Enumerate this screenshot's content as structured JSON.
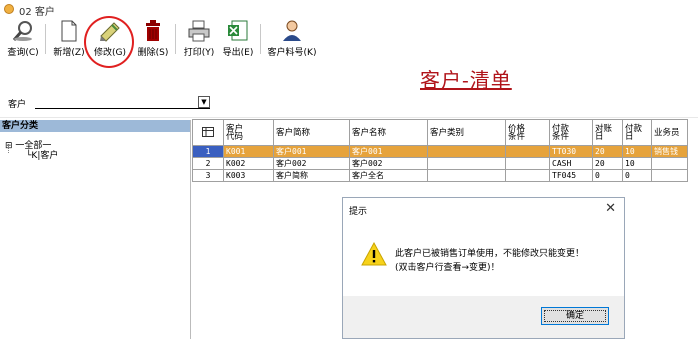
{
  "window": {
    "title": "02 客户",
    "icon": "app-icon"
  },
  "toolbar": {
    "query": "查询(C)",
    "add": "新增(Z)",
    "edit": "修改(G)",
    "delete": "删除(S)",
    "print": "打印(Y)",
    "export": "导出(E)",
    "customer_file": "客户料号(K)"
  },
  "page_title": "客户-清单",
  "filter": {
    "label": "客户",
    "value": ""
  },
  "tree": {
    "header": "客户分类",
    "root": "一全部一",
    "child": "K|客户"
  },
  "grid": {
    "columns": [
      "客户\n代码",
      "客户简称",
      "客户名称",
      "客户类别",
      "价格\n条件",
      "付款\n条件",
      "对账\n日",
      "付款\n日",
      "业务员"
    ],
    "rows": [
      {
        "idx": "1",
        "cells": [
          "K001",
          "客户001",
          "客户001",
          "",
          "",
          "TT030",
          "20",
          "10",
          "销售钱"
        ]
      },
      {
        "idx": "2",
        "cells": [
          "K002",
          "客户002",
          "客户002",
          "",
          "",
          "CASH",
          "20",
          "10",
          ""
        ]
      },
      {
        "idx": "3",
        "cells": [
          "K003",
          "客户简称",
          "客户全名",
          "",
          "",
          "TF045",
          "0",
          "0",
          ""
        ]
      }
    ]
  },
  "dialog": {
    "title": "提示",
    "message_line1": "此客户已被销售订单使用，不能修改只能变更！",
    "message_line2": "(双击客户行查看→变更)！",
    "ok": "确定"
  },
  "colors": {
    "title_red": "#b0141a",
    "selected_row": "#e6a33c",
    "tree_header": "#9db9d8",
    "annotation_ring": "#e02020"
  }
}
